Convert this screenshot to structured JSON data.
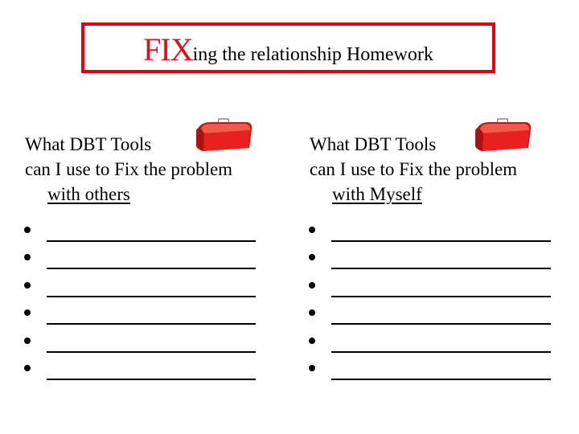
{
  "title": {
    "emphasis": "FIX",
    "rest": "ing the relationship Homework"
  },
  "colors": {
    "border": "#e8000b",
    "emphasis": "#d8141b",
    "toolbox": "#e8201e"
  },
  "columns": [
    {
      "line1": "What DBT Tools",
      "line2": "can I use to Fix the problem",
      "line3": "with others",
      "icon": "toolbox-icon",
      "blank_count": 6
    },
    {
      "line1": "What DBT Tools",
      "line2": "can I use to Fix the problem",
      "line3": "with Myself",
      "icon": "toolbox-icon",
      "blank_count": 6
    }
  ]
}
